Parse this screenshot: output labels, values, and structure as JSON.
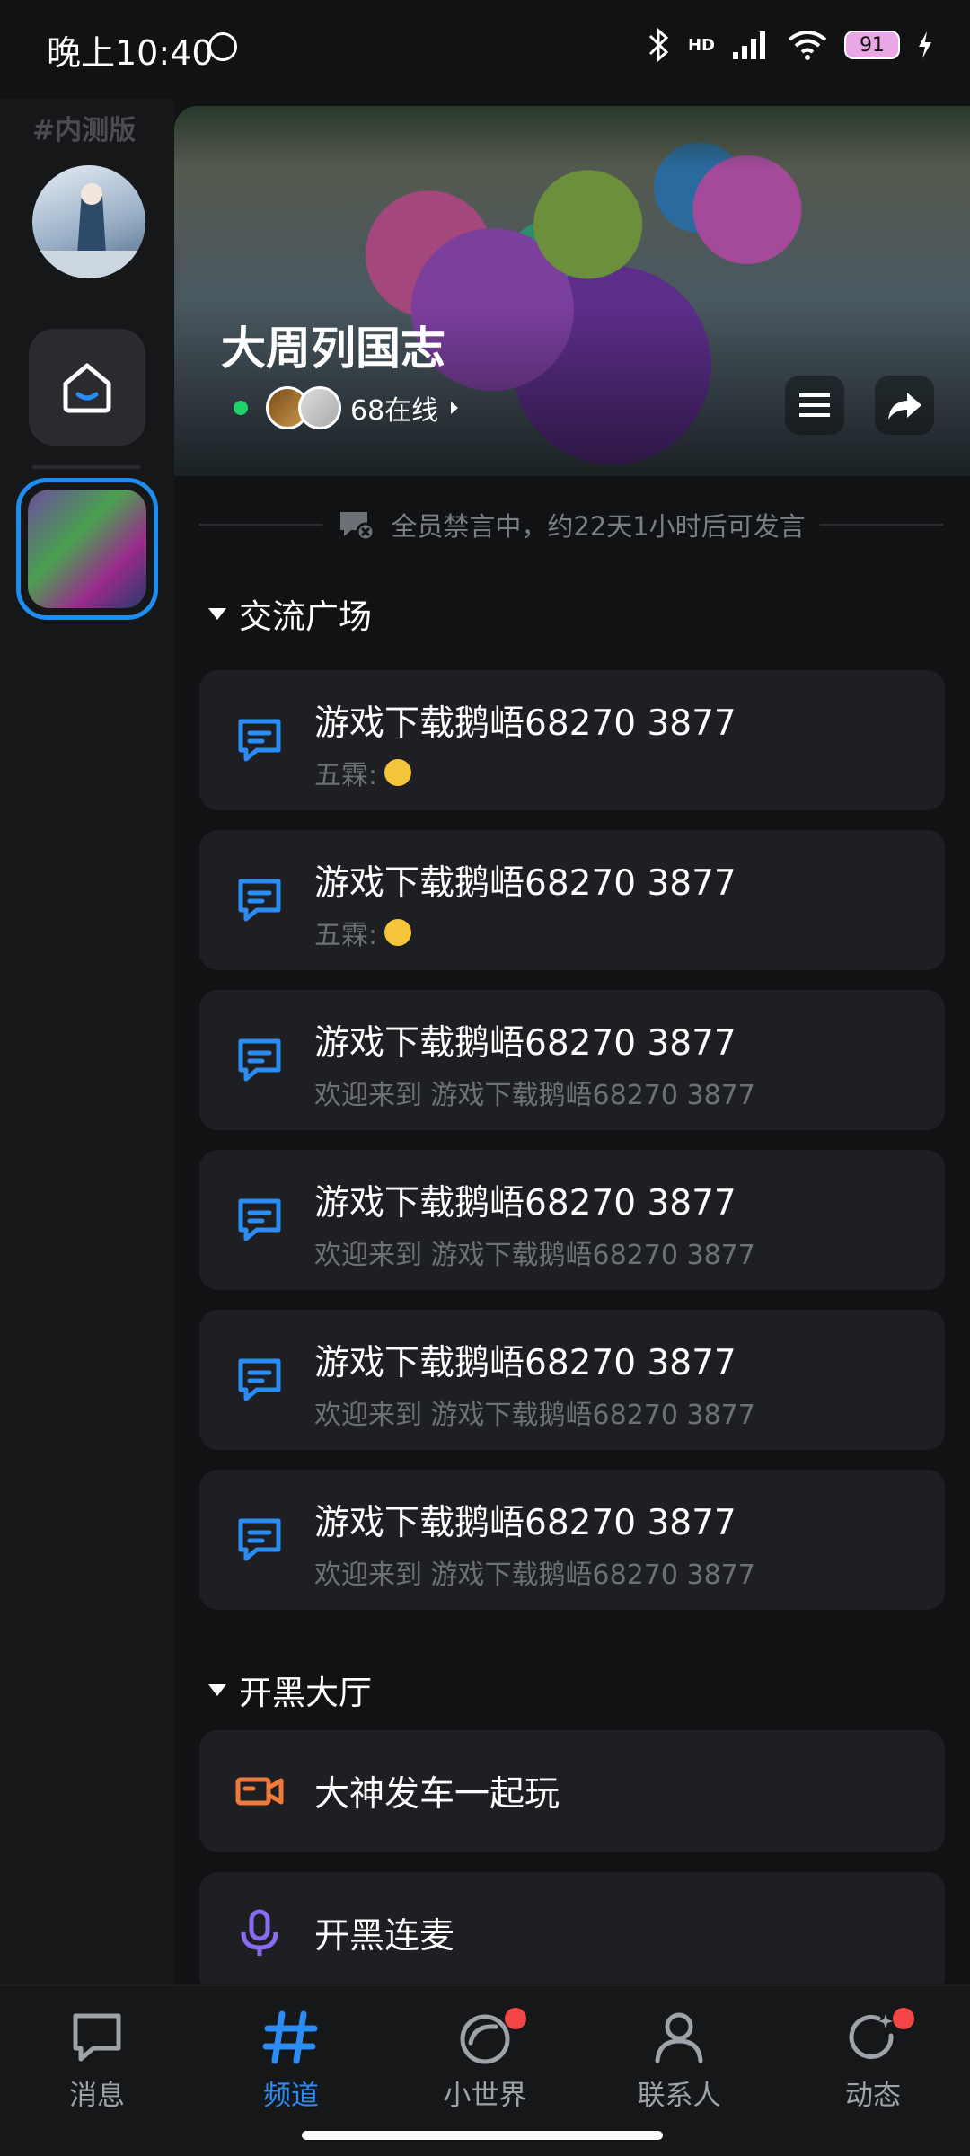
{
  "status_bar": {
    "time": "晚上10:40",
    "network": "HD",
    "battery": "91"
  },
  "sidebar": {
    "tag": "#内测版"
  },
  "channel": {
    "title": "大周列国志",
    "online_text": "68在线"
  },
  "notice": "全员禁言中，约22天1小时后可发言",
  "sections": [
    {
      "title": "交流广场",
      "items": [
        {
          "title": "游戏下载鹅峿68270  3877",
          "subtitle": "五霖:",
          "emoji": "rolling-eyes"
        },
        {
          "title": "游戏下载鹅峿68270  3877",
          "subtitle": "五霖:",
          "emoji": "heart-eyes"
        },
        {
          "title": "游戏下载鹅峿68270  3877",
          "subtitle": "欢迎来到 游戏下载鹅峿68270  3877"
        },
        {
          "title": "游戏下载鹅峿68270  3877",
          "subtitle": "欢迎来到 游戏下载鹅峿68270  3877"
        },
        {
          "title": "游戏下载鹅峿68270  3877",
          "subtitle": "欢迎来到 游戏下载鹅峿68270  3877"
        },
        {
          "title": "游戏下载鹅峿68270  3877",
          "subtitle": "欢迎来到 游戏下载鹅峿68270  3877"
        }
      ]
    },
    {
      "title": "开黑大厅",
      "items": [
        {
          "title": "大神发车一起玩",
          "icon": "video-camera-icon"
        },
        {
          "title": "开黑连麦",
          "icon": "microphone-icon"
        }
      ]
    }
  ],
  "tabbar": [
    {
      "label": "消息",
      "icon": "chat-bubble-icon",
      "active": false
    },
    {
      "label": "频道",
      "icon": "hash-icon",
      "active": true
    },
    {
      "label": "小世界",
      "icon": "planet-icon",
      "active": false,
      "badge": true
    },
    {
      "label": "联系人",
      "icon": "person-icon",
      "active": false
    },
    {
      "label": "动态",
      "icon": "refresh-star-icon",
      "active": false,
      "badge": true
    }
  ],
  "colors": {
    "accent": "#2b8cf5",
    "background": "#111214",
    "card": "#1e1f23",
    "video_icon": "#f07a3a",
    "mic_icon": "#8a6cf2",
    "badge": "#f04646"
  }
}
